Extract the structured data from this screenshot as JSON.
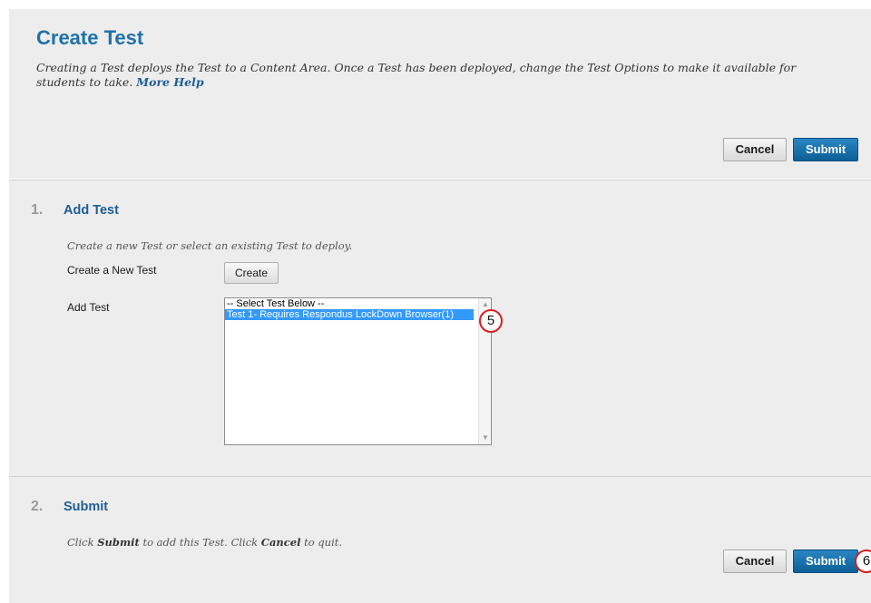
{
  "header": {
    "title": "Create Test",
    "description": "Creating a Test deploys the Test to a Content Area. Once a Test has been deployed, change the Test Options to make it available for students to take.",
    "help_link": "More Help",
    "cancel_label": "Cancel",
    "submit_label": "Submit"
  },
  "step1": {
    "number": "1.",
    "title": "Add Test",
    "instruction": "Create a new Test or select an existing Test to deploy.",
    "create_label": "Create a New Test",
    "create_button": "Create",
    "add_label": "Add Test",
    "options": [
      "-- Select Test Below --",
      "Test 1- Requires Respondus LockDown Browser(1)"
    ],
    "selected_index": 1,
    "callout": "5"
  },
  "step2": {
    "number": "2.",
    "title": "Submit",
    "instruction_pre": "Click ",
    "instruction_submit": "Submit",
    "instruction_mid": " to add this Test. Click ",
    "instruction_cancel": "Cancel",
    "instruction_post": " to quit.",
    "cancel_label": "Cancel",
    "submit_label": "Submit",
    "callout": "6"
  },
  "colors": {
    "title": "#1e73a8",
    "submit_button": "#1a6fa8",
    "selection": "#3399ff",
    "callout_ring": "#d42020"
  },
  "icons": {
    "scroll_up": "scroll-up-arrow-icon",
    "scroll_down": "scroll-down-arrow-icon"
  }
}
